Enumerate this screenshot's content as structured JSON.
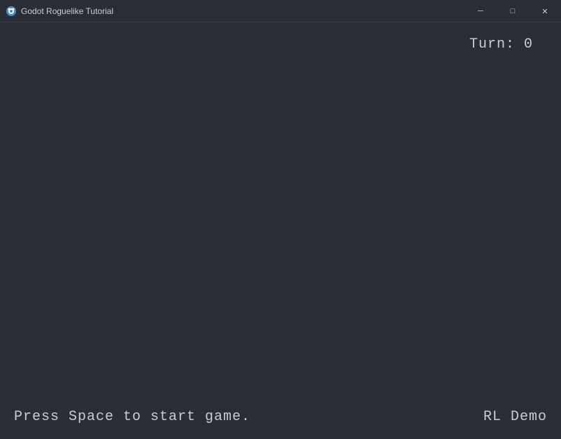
{
  "titlebar": {
    "title": "Godot Roguelike Tutorial",
    "minimize_label": "─",
    "maximize_label": "□",
    "close_label": "✕"
  },
  "game": {
    "turn_label": "Turn: 0",
    "press_space_label": "Press Space to start game.",
    "rl_demo_label": "RL Demo"
  }
}
